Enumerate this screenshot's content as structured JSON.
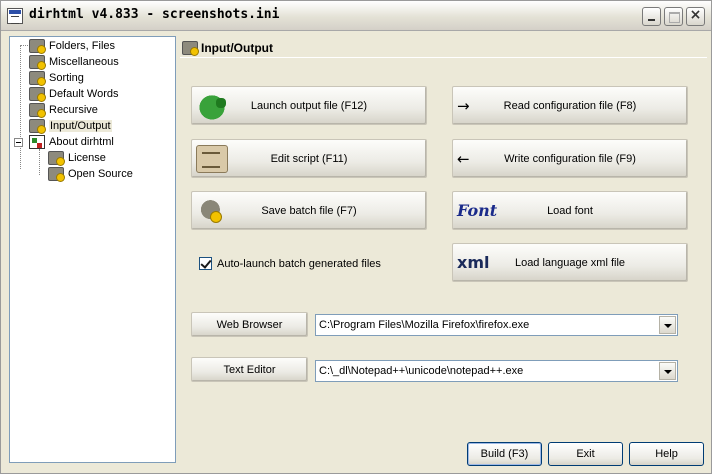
{
  "window": {
    "title": "dirhtml v4.833 - screenshots.ini"
  },
  "tree": {
    "items": [
      {
        "label": "Folders, Files",
        "icon": "gear-icon"
      },
      {
        "label": "Miscellaneous",
        "icon": "gear-icon"
      },
      {
        "label": "Sorting",
        "icon": "gear-icon"
      },
      {
        "label": "Default Words",
        "icon": "gear-icon"
      },
      {
        "label": "Recursive",
        "icon": "gear-icon"
      },
      {
        "label": "Input/Output",
        "icon": "gear-icon",
        "selected": true
      },
      {
        "label": "About dirhtml",
        "icon": "book-icon"
      },
      {
        "label": "License",
        "icon": "gear-icon"
      },
      {
        "label": "Open Source",
        "icon": "gear-icon"
      }
    ]
  },
  "panel": {
    "title": "Input/Output",
    "buttons": {
      "launch_output": "Launch output file (F12)",
      "edit_script": "Edit script (F11)",
      "save_batch": "Save batch file (F7)",
      "read_config": "Read configuration file (F8)",
      "write_config": "Write configuration file (F9)",
      "load_font": "Load font",
      "load_language": "Load language xml file"
    },
    "icons": {
      "read_config": "→",
      "write_config": "←",
      "font": "Font",
      "xml": "xml"
    },
    "auto_launch": {
      "label": "Auto-launch batch generated files",
      "checked": true
    },
    "web_browser": {
      "button": "Web Browser",
      "value": "C:\\Program Files\\Mozilla Firefox\\firefox.exe"
    },
    "text_editor": {
      "button": "Text Editor",
      "value": "C:\\_dl\\Notepad++\\unicode\\notepad++.exe"
    }
  },
  "footer": {
    "build": "Build (F3)",
    "exit": "Exit",
    "help": "Help"
  }
}
